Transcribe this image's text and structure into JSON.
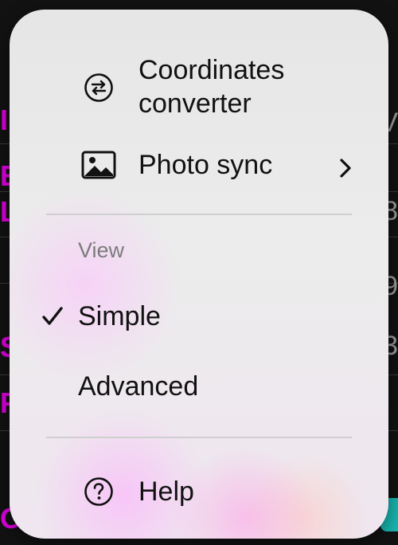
{
  "background": {
    "left_letters": [
      "I",
      "E",
      "L",
      "S",
      "F",
      "O"
    ],
    "right_glyphs": [
      "V",
      "8",
      "9",
      "3"
    ]
  },
  "menu": {
    "coordinates_converter": {
      "label_line1": "Coordinates",
      "label_line2": "converter",
      "icon": "arrows-exchange-circle-icon"
    },
    "photo_sync": {
      "label": "Photo sync",
      "icon": "photo-icon",
      "chevron": "chevron-right-icon"
    },
    "view_section": {
      "title": "View",
      "options": [
        {
          "label": "Simple",
          "selected": true
        },
        {
          "label": "Advanced",
          "selected": false
        }
      ]
    },
    "help": {
      "label": "Help",
      "icon": "question-circle-icon"
    }
  }
}
